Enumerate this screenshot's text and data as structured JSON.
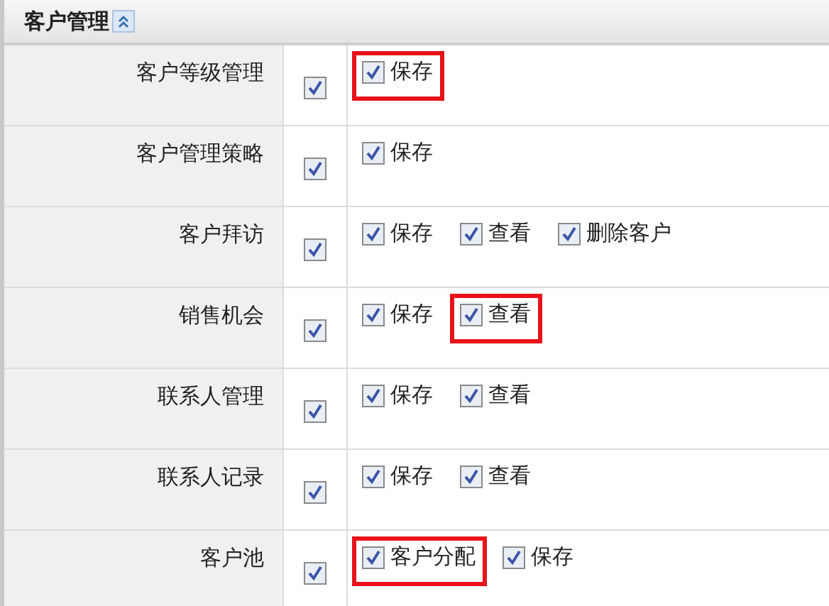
{
  "section": {
    "title": "客户管理",
    "expanded": true
  },
  "rows": [
    {
      "name": "客户等级管理",
      "checked": true,
      "permissions": [
        {
          "label": "保存",
          "checked": true,
          "highlighted": true
        }
      ]
    },
    {
      "name": "客户管理策略",
      "checked": true,
      "permissions": [
        {
          "label": "保存",
          "checked": true,
          "highlighted": false
        }
      ]
    },
    {
      "name": "客户拜访",
      "checked": true,
      "permissions": [
        {
          "label": "保存",
          "checked": true,
          "highlighted": false
        },
        {
          "label": "查看",
          "checked": true,
          "highlighted": false
        },
        {
          "label": "删除客户",
          "checked": true,
          "highlighted": false
        }
      ]
    },
    {
      "name": "销售机会",
      "checked": true,
      "permissions": [
        {
          "label": "保存",
          "checked": true,
          "highlighted": false
        },
        {
          "label": "查看",
          "checked": true,
          "highlighted": true
        }
      ]
    },
    {
      "name": "联系人管理",
      "checked": true,
      "permissions": [
        {
          "label": "保存",
          "checked": true,
          "highlighted": false
        },
        {
          "label": "查看",
          "checked": true,
          "highlighted": false
        }
      ]
    },
    {
      "name": "联系人记录",
      "checked": true,
      "permissions": [
        {
          "label": "保存",
          "checked": true,
          "highlighted": false
        },
        {
          "label": "查看",
          "checked": true,
          "highlighted": false
        }
      ]
    },
    {
      "name": "客户池",
      "checked": true,
      "permissions": [
        {
          "label": "客户分配",
          "checked": true,
          "highlighted": true
        },
        {
          "label": "保存",
          "checked": true,
          "highlighted": false
        }
      ]
    }
  ]
}
